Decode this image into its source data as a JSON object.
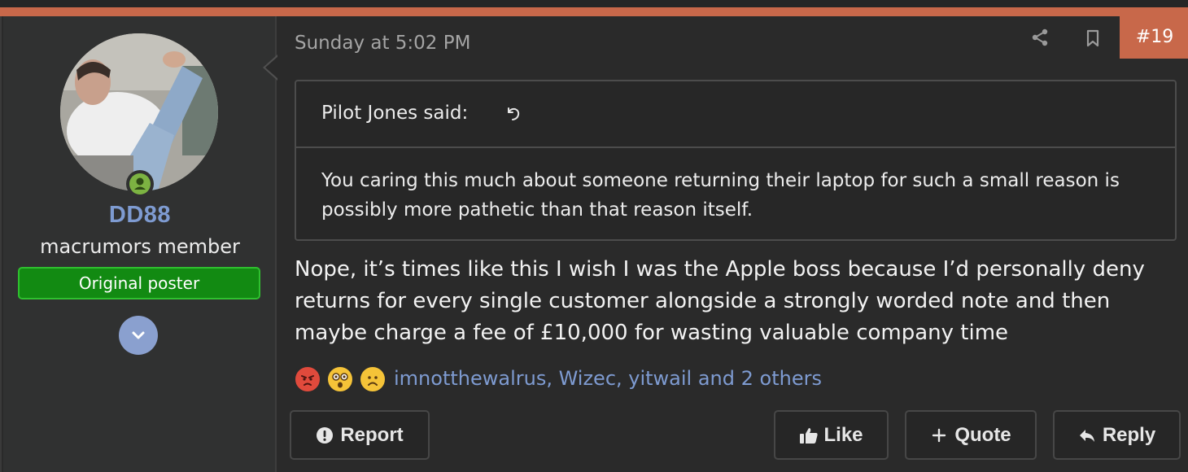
{
  "user": {
    "name": "DD88",
    "title": "macrumors member",
    "banner": "Original poster",
    "status": "online"
  },
  "post": {
    "date": "Sunday at 5:02 PM",
    "number": "#19",
    "quote": {
      "attribution": "Pilot Jones said:",
      "text": "You caring this much about someone returning their laptop for such a small reason is possibly more pathetic than that reason itself."
    },
    "message": "Nope, it’s times like this I wish I was the Apple boss because I’d personally deny returns for every single customer alongside a strongly worded note and then maybe charge a fee of £10,000 for wasting valuable company time",
    "reactions": {
      "icons": [
        "angry-icon",
        "astonished-icon",
        "frown-icon"
      ],
      "users": "imnotthewalrus, Wizec, yitwail and 2 others"
    }
  },
  "actions": {
    "report": "Report",
    "like": "Like",
    "quote": "Quote",
    "reply": "Reply"
  },
  "colors": {
    "accent": "#c8684a",
    "link": "#7e9bd1",
    "banner_bg": "#128a12",
    "online": "#7cb342"
  }
}
